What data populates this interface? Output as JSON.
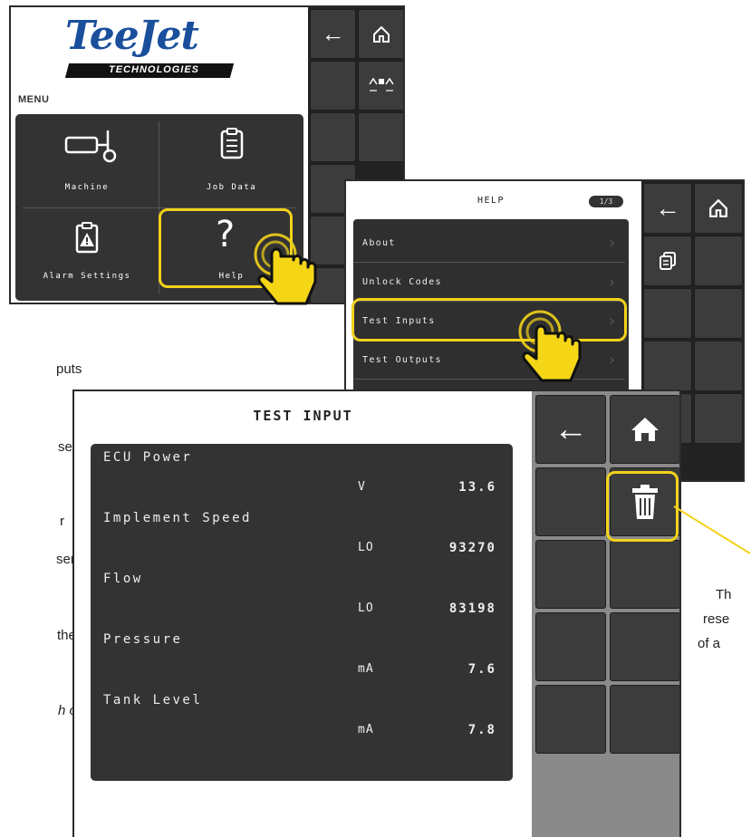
{
  "doc_fragments": [
    "puts",
    "sensor",
    "r",
    "sensor.",
    "the",
    "h other,"
  ],
  "callout_lines": [
    "Th",
    "rese",
    "of a"
  ],
  "screen1": {
    "logo_main": "TeeJet",
    "logo_sub": "TECHNOLOGIES",
    "menu_title": "MENU",
    "items": [
      {
        "label": "Machine",
        "icon": "machine-icon"
      },
      {
        "label": "Job Data",
        "icon": "clipboard-icon"
      },
      {
        "label": "Alarm Settings",
        "icon": "alarm-icon"
      },
      {
        "label": "Help",
        "icon": "help-icon"
      }
    ],
    "side_icons": [
      "back-arrow-icon",
      "home-icon",
      "boom-width-icon"
    ]
  },
  "screen2": {
    "title": "HELP",
    "page_indicator": "1/3",
    "rows": [
      "About",
      "Unlock Codes",
      "Test Inputs",
      "Test Outputs"
    ],
    "side_icons": [
      "back-arrow-icon",
      "home-icon",
      "copy-icon"
    ]
  },
  "screen3": {
    "title": "TEST INPUT",
    "rows": [
      {
        "name": "ECU Power",
        "unit": "V",
        "value": "13.6"
      },
      {
        "name": "Implement Speed",
        "unit": "LO",
        "value": "93270"
      },
      {
        "name": "Flow",
        "unit": "LO",
        "value": "83198"
      },
      {
        "name": "Pressure",
        "unit": "mA",
        "value": "7.6"
      },
      {
        "name": "Tank Level",
        "unit": "mA",
        "value": "7.8"
      }
    ],
    "side_icons": [
      "back-arrow-icon",
      "home-icon",
      "trash-icon"
    ]
  },
  "colors": {
    "highlight": "#f2d21b",
    "panel": "#333333",
    "grid": "#3c3c3c"
  }
}
